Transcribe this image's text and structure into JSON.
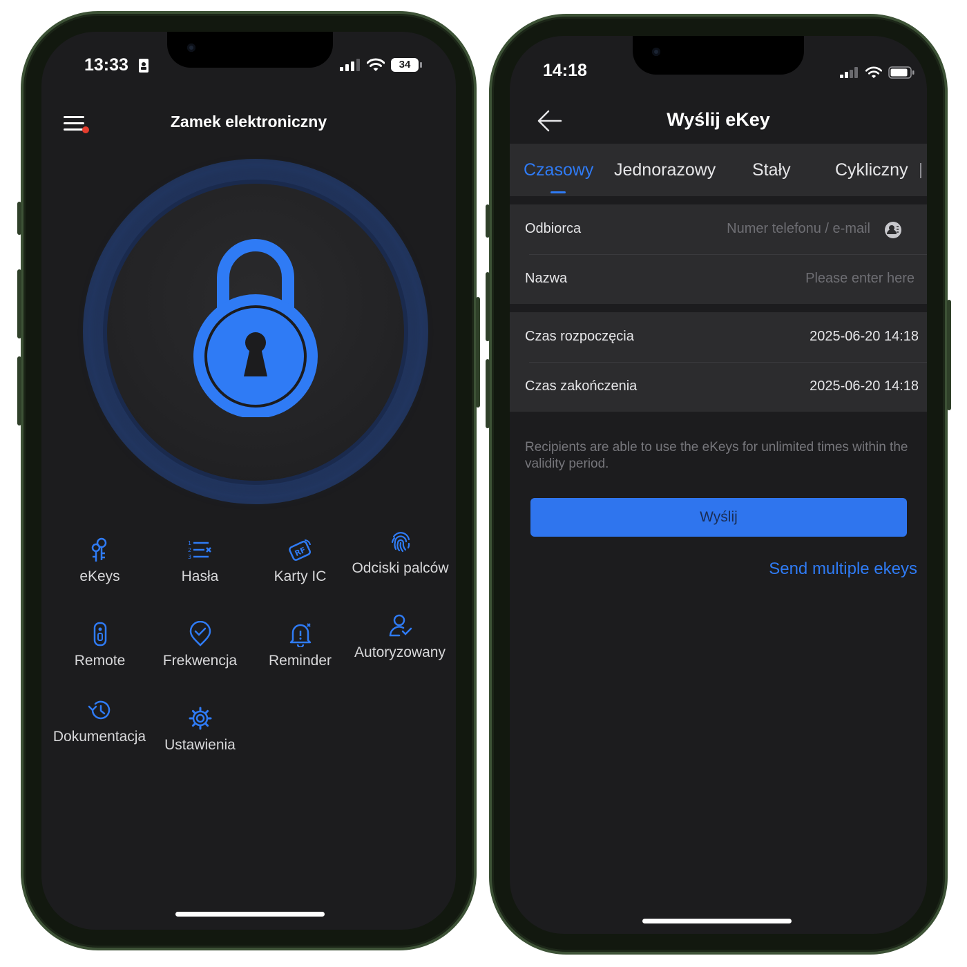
{
  "left_phone": {
    "status": {
      "time": "13:33",
      "battery": "34"
    },
    "header": {
      "title": "Zamek elektroniczny"
    },
    "grid": [
      {
        "label": "eKeys",
        "icon": "ekeys-icon"
      },
      {
        "label": "Hasła",
        "icon": "passwords-icon"
      },
      {
        "label": "Karty IC",
        "icon": "rf-card-icon"
      },
      {
        "label": "Odciski palców",
        "icon": "fingerprint-icon"
      },
      {
        "label": "Remote",
        "icon": "remote-icon"
      },
      {
        "label": "Frekwencja",
        "icon": "attendance-icon"
      },
      {
        "label": "Reminder",
        "icon": "bell-icon"
      },
      {
        "label": "Autoryzowany",
        "icon": "authorized-user-icon"
      },
      {
        "label": "Dokumentacja",
        "icon": "history-icon"
      },
      {
        "label": "Ustawienia",
        "icon": "settings-gear-icon"
      }
    ],
    "accent": "#2f7bf5"
  },
  "right_phone": {
    "status": {
      "time": "14:18"
    },
    "header": {
      "title": "Wyślij eKey"
    },
    "tabs": [
      {
        "label": "Czasowy",
        "active": true
      },
      {
        "label": "Jednorazowy"
      },
      {
        "label": "Stały"
      },
      {
        "label": "Cykliczny"
      }
    ],
    "form": {
      "recipient_label": "Odbiorca",
      "recipient_placeholder": "Numer telefonu / e-mail",
      "name_label": "Nazwa",
      "name_placeholder": "Please enter here",
      "start_label": "Czas rozpoczęcia",
      "start_value": "2025-06-20 14:18",
      "end_label": "Czas zakończenia",
      "end_value": "2025-06-20 14:18"
    },
    "hint": "Recipients are able to use the eKeys for unlimited times within the validity period.",
    "send_button": "Wyślij",
    "multi_link": "Send multiple ekeys",
    "accent": "#2f7bf5"
  }
}
